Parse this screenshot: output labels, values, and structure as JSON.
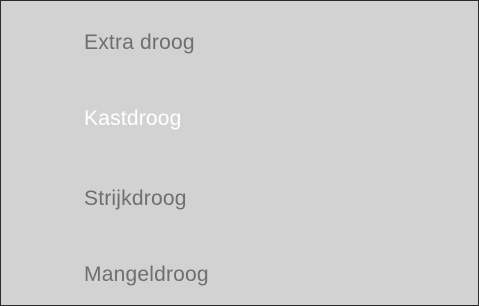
{
  "dryness_menu": {
    "options": [
      {
        "label": "Extra droog",
        "selected": false
      },
      {
        "label": "Kastdroog",
        "selected": true
      },
      {
        "label": "Strijkdroog",
        "selected": false
      },
      {
        "label": "Mangeldroog",
        "selected": false
      }
    ]
  },
  "colors": {
    "background": "#d2d2d2",
    "option_text": "#6f6f6f",
    "selected_text": "#ffffff",
    "border": "#2a2a2a"
  }
}
